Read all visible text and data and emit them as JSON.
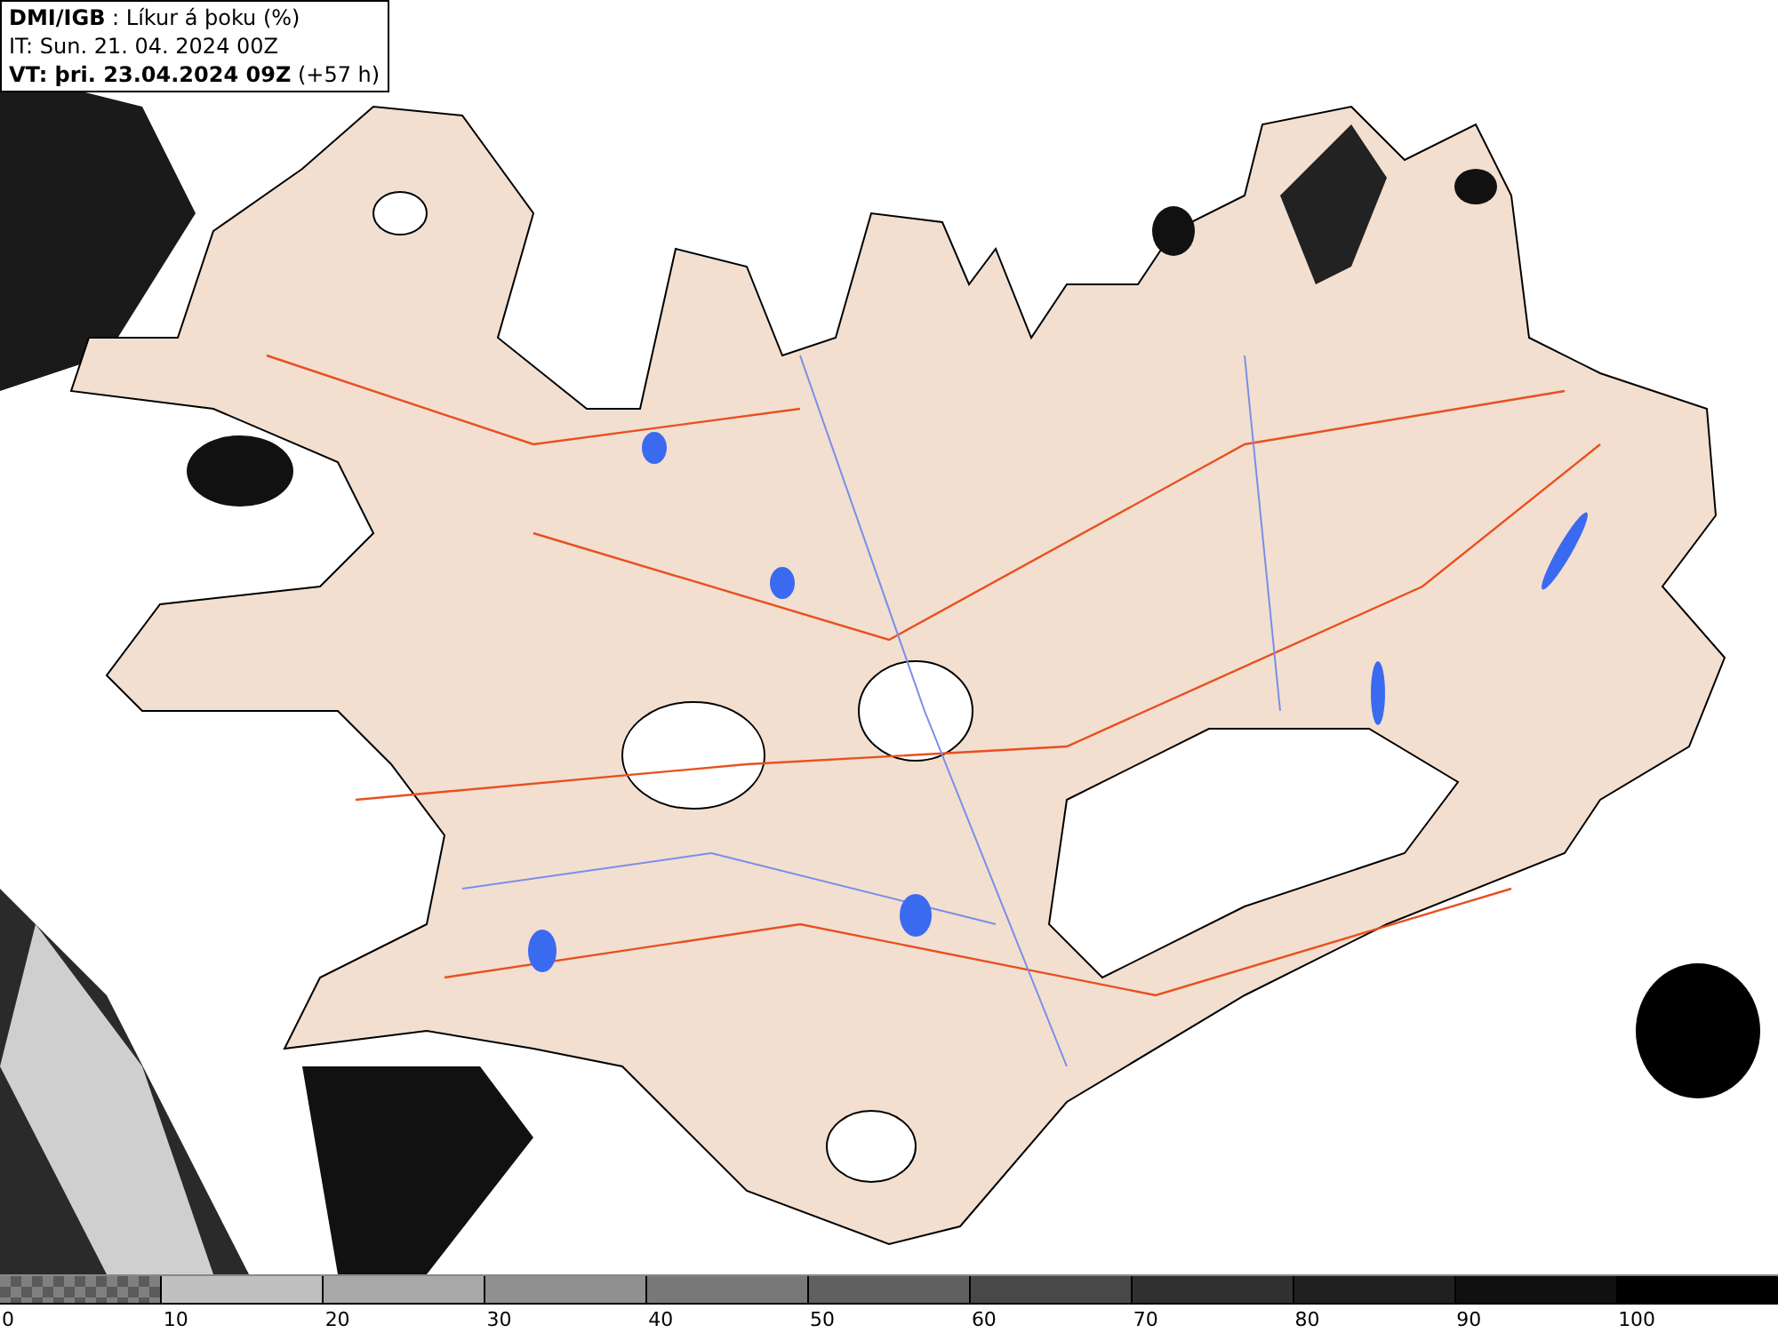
{
  "header": {
    "lines": [
      "**DMI/IGB** : Líkur á þoku (%)",
      "IT: Sun. 21. 04. 2024 00Z",
      "**VT: þri. 23.04.2024 09Z** (+57 h)"
    ]
  },
  "legend": {
    "segments": [
      {
        "kind": "checker",
        "color": "#808080"
      },
      {
        "kind": "solid",
        "color": "#c0c0c0"
      },
      {
        "kind": "solid",
        "color": "#a8a8a8"
      },
      {
        "kind": "solid",
        "color": "#909090"
      },
      {
        "kind": "solid",
        "color": "#787878"
      },
      {
        "kind": "solid",
        "color": "#606060"
      },
      {
        "kind": "solid",
        "color": "#484848"
      },
      {
        "kind": "solid",
        "color": "#303030"
      },
      {
        "kind": "solid",
        "color": "#202020"
      },
      {
        "kind": "solid",
        "color": "#101010"
      },
      {
        "kind": "solid",
        "color": "#000000"
      }
    ],
    "labels": [
      "0",
      "10",
      "20",
      "30",
      "40",
      "50",
      "60",
      "70",
      "80",
      "90",
      "100"
    ]
  }
}
